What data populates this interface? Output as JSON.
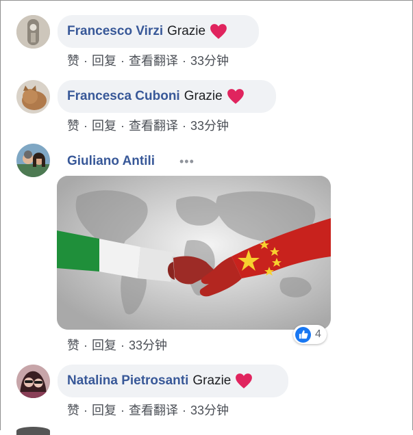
{
  "comments": [
    {
      "name": "Francesco Virzi",
      "text": "Grazie",
      "actions": {
        "like": "赞",
        "reply": "回复",
        "translate": "查看翻译",
        "time": "33分钟"
      }
    },
    {
      "name": "Francesca Cuboni",
      "text": "Grazie",
      "actions": {
        "like": "赞",
        "reply": "回复",
        "translate": "查看翻译",
        "time": "33分钟"
      }
    },
    {
      "name": "Giuliano Antili",
      "more": "•••",
      "actions": {
        "like": "赞",
        "reply": "回复",
        "time": "33分钟"
      },
      "reaction_count": "4"
    },
    {
      "name": "Natalina Pietrosanti",
      "text": "Grazie",
      "actions": {
        "like": "赞",
        "reply": "回复",
        "translate": "查看翻译",
        "time": "33分钟"
      }
    }
  ],
  "separator": "·",
  "colors": {
    "name": "#385898",
    "bubble": "#f0f2f5",
    "like": "#1877f2",
    "heart": "#e0245e"
  }
}
